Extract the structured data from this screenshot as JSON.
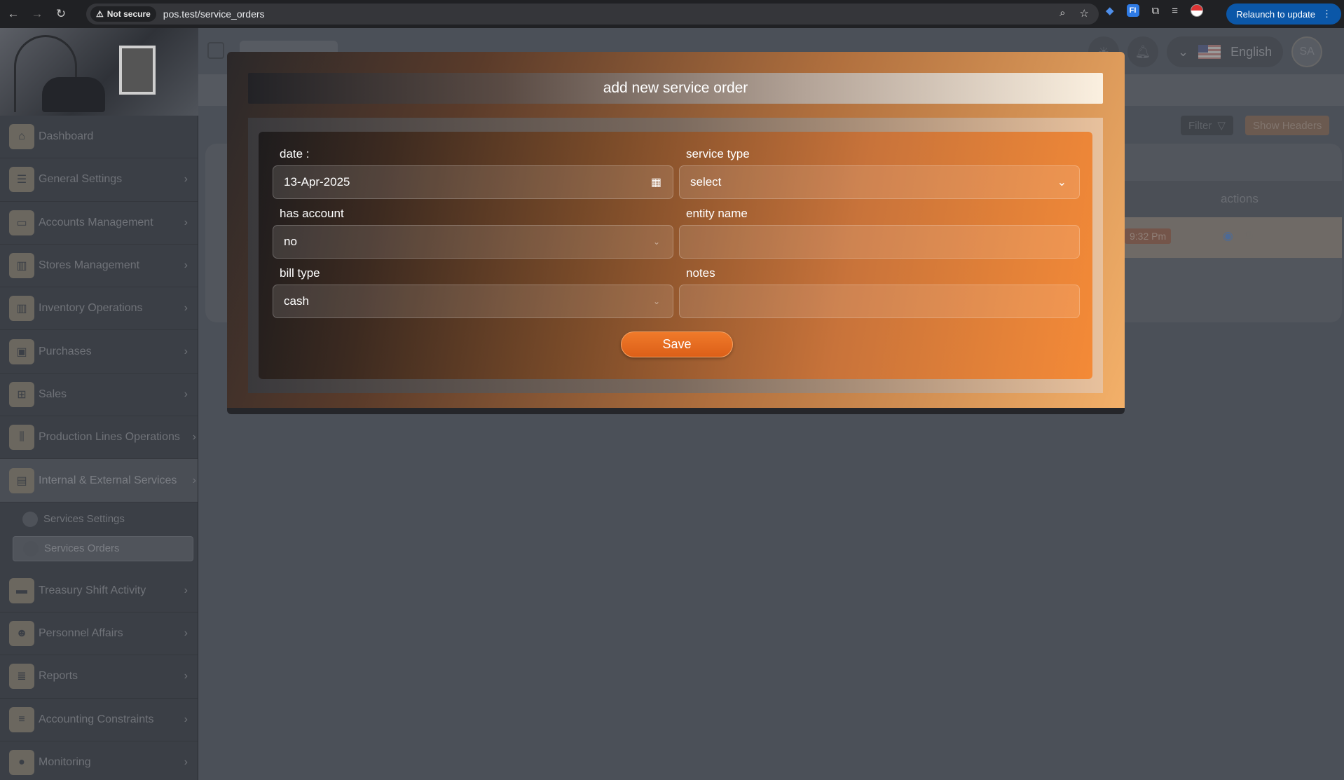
{
  "browser": {
    "security_label": "Not secure",
    "url": "pos.test/service_orders",
    "relaunch_label": "Relaunch to update",
    "ext_label": "FI"
  },
  "sidebar": {
    "items": [
      {
        "label": "Dashboard",
        "icon": "home-icon"
      },
      {
        "label": "General Settings",
        "icon": "sliders-icon"
      },
      {
        "label": "Accounts Management",
        "icon": "wallet-icon"
      },
      {
        "label": "Stores Management",
        "icon": "building-icon"
      },
      {
        "label": "Inventory Operations",
        "icon": "building-icon"
      },
      {
        "label": "Purchases",
        "icon": "bag-icon"
      },
      {
        "label": "Sales",
        "icon": "cart-icon"
      },
      {
        "label": "Production Lines Operations",
        "icon": "factory-icon"
      },
      {
        "label": "Internal & External Services",
        "icon": "services-icon"
      },
      {
        "label": "Treasury Shift Activity",
        "icon": "card-icon"
      },
      {
        "label": "Personnel Affairs",
        "icon": "people-icon"
      },
      {
        "label": "Reports",
        "icon": "list-icon"
      },
      {
        "label": "Accounting Constraints",
        "icon": "list-icon"
      },
      {
        "label": "Monitoring",
        "icon": "circle-icon"
      }
    ],
    "submenu": [
      {
        "label": "Services Settings"
      },
      {
        "label": "Services Orders"
      }
    ]
  },
  "topbar": {
    "language": "English",
    "avatar_initials": "SA"
  },
  "page": {
    "filter_label": "Filter",
    "show_headers_label": "Show Headers",
    "actions_header": "actions",
    "time_value": "9:32 Pm"
  },
  "modal": {
    "title": "add new service order",
    "date_label": "date :",
    "date_value": "13-Apr-2025",
    "service_type_label": "service type",
    "service_type_value": "select",
    "has_account_label": "has account",
    "has_account_value": "no",
    "entity_name_label": "entity name",
    "entity_name_value": "",
    "bill_type_label": "bill type",
    "bill_type_value": "cash",
    "notes_label": "notes",
    "notes_value": "",
    "save_label": "Save"
  }
}
